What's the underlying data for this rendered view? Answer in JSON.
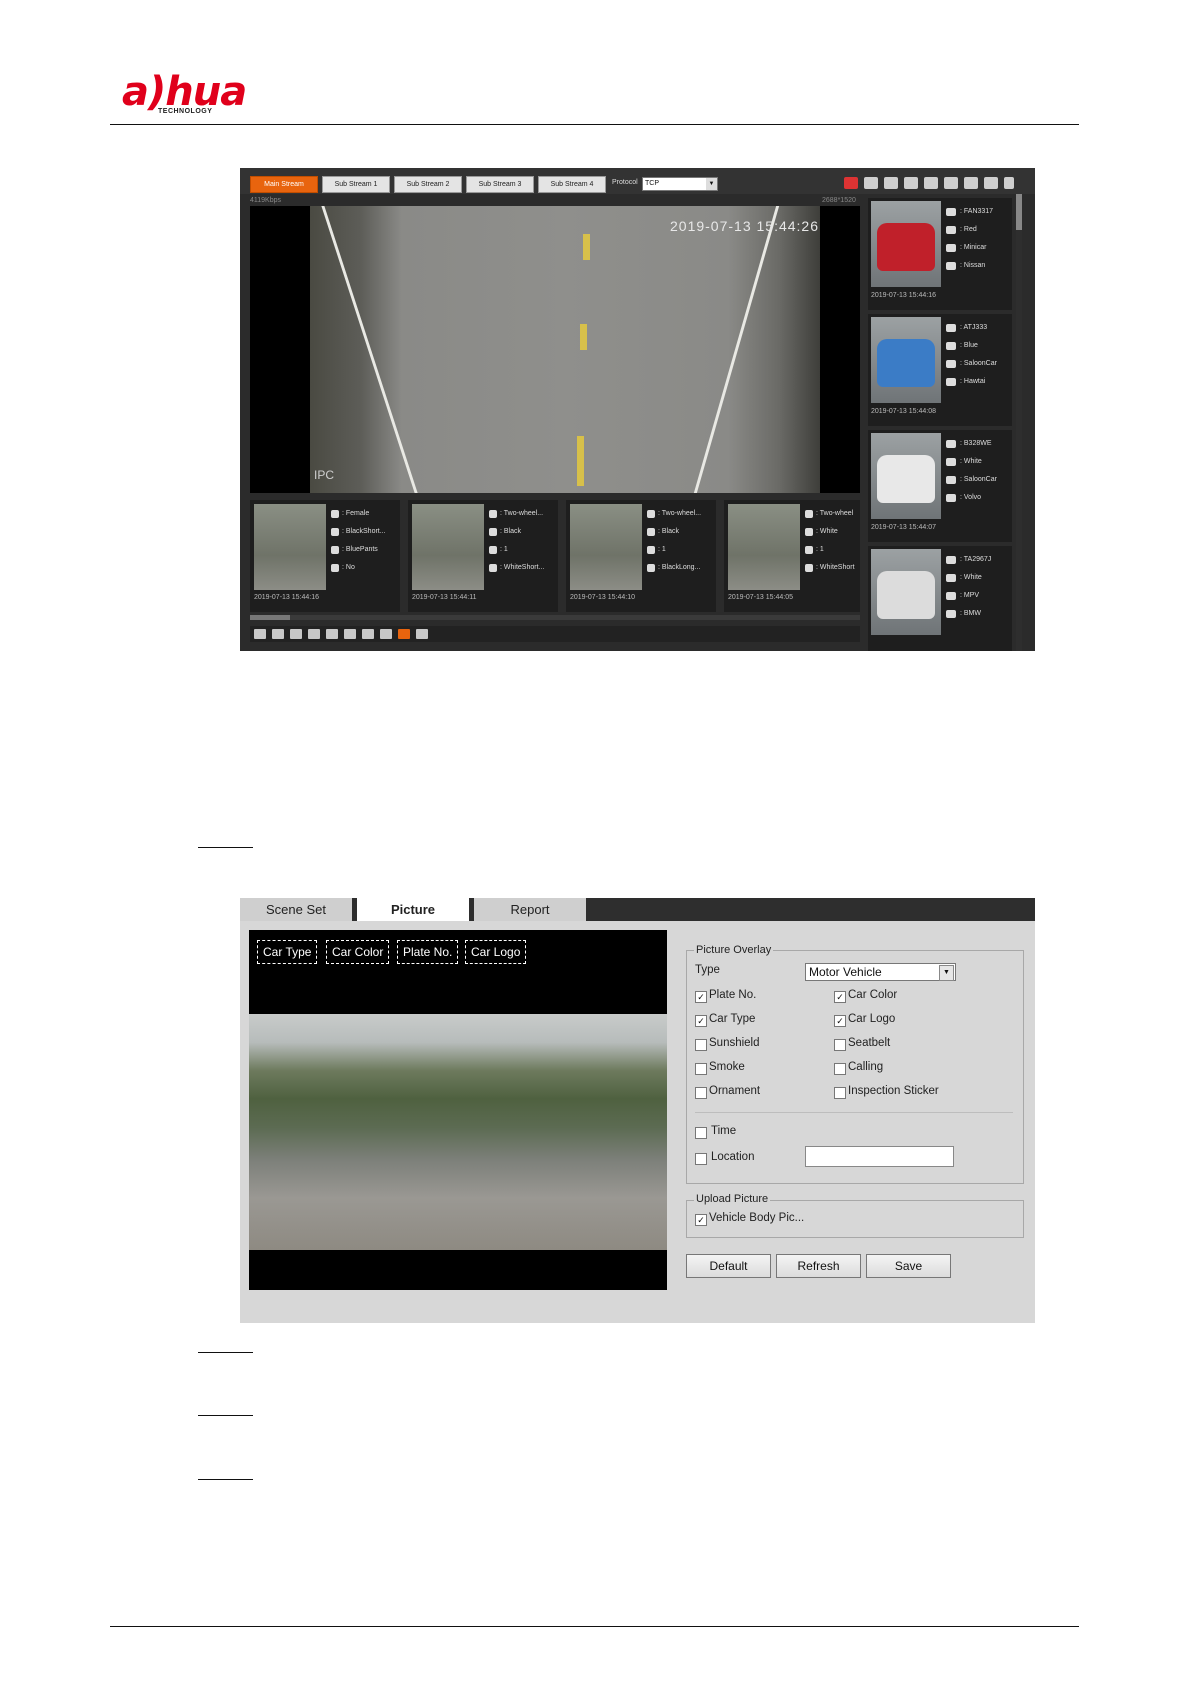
{
  "header": {
    "logo_text": "a)hua",
    "logo_subtext": "TECHNOLOGY"
  },
  "live_view": {
    "stream_tabs": [
      "Main Stream",
      "Sub Stream 1",
      "Sub Stream 2",
      "Sub Stream 3",
      "Sub Stream 4"
    ],
    "protocol_label": "Protocol",
    "protocol_value": "TCP",
    "bitrate": "4119Kbps",
    "resolution": "2688*1520",
    "osd_time": "2019-07-13 15:44:26",
    "osd_label": "IPC",
    "people": [
      {
        "attrs": [
          ": Female",
          ": BlackShort...",
          ": BluePants",
          ": No"
        ],
        "time": "2019-07-13 15:44:16"
      },
      {
        "attrs": [
          ": Two-wheel...",
          ": Black",
          ": 1",
          ": WhiteShort..."
        ],
        "time": "2019-07-13 15:44:11"
      },
      {
        "attrs": [
          ": Two-wheel...",
          ": Black",
          ": 1",
          ": BlackLong..."
        ],
        "time": "2019-07-13 15:44:10"
      },
      {
        "attrs": [
          ": Two-wheel",
          ": White",
          ": 1",
          ": WhiteShort"
        ],
        "time": "2019-07-13 15:44:05"
      }
    ],
    "vehicles": [
      {
        "plate": ": FAN3317",
        "color": ": Red",
        "type": ": Minicar",
        "logo": ": Nissan",
        "time": "2019-07-13 15:44:16",
        "car_color": "#c0202a"
      },
      {
        "plate": ": ATJ333",
        "color": ": Blue",
        "type": ": SaloonCar",
        "logo": ": Hawtai",
        "time": "2019-07-13 15:44:08",
        "car_color": "#3b7cc6"
      },
      {
        "plate": ": B328WE",
        "color": ": White",
        "type": ": SaloonCar",
        "logo": ": Volvo",
        "time": "2019-07-13 15:44:07",
        "car_color": "#e8e8e8"
      },
      {
        "plate": ": TA2967J",
        "color": ": White",
        "type": ": MPV",
        "logo": ": BMW",
        "time": "",
        "car_color": "#dcdcdc"
      }
    ]
  },
  "picture_config": {
    "tabs": [
      "Scene Set",
      "Picture",
      "Report"
    ],
    "active_tab": "Picture",
    "overlay_boxes": [
      "Car Type",
      "Car Color",
      "Plate No.",
      "Car Logo"
    ],
    "overlay_group_title": "Picture Overlay",
    "type_label": "Type",
    "type_value": "Motor Vehicle",
    "checkboxes": [
      {
        "label": "Plate No.",
        "checked": true
      },
      {
        "label": "Car Color",
        "checked": true
      },
      {
        "label": "Car Type",
        "checked": true
      },
      {
        "label": "Car Logo",
        "checked": true
      },
      {
        "label": "Sunshield",
        "checked": false
      },
      {
        "label": "Seatbelt",
        "checked": false
      },
      {
        "label": "Smoke",
        "checked": false
      },
      {
        "label": "Calling",
        "checked": false
      },
      {
        "label": "Ornament",
        "checked": false
      },
      {
        "label": "Inspection Sticker",
        "checked": false
      }
    ],
    "time_label": "Time",
    "location_label": "Location",
    "location_value": "",
    "upload_group_title": "Upload Picture",
    "upload_checkbox_label": "Vehicle Body Pic...",
    "buttons": [
      "Default",
      "Refresh",
      "Save"
    ]
  },
  "colors": {
    "brand_red": "#e0001b",
    "accent_orange": "#e8640e"
  }
}
